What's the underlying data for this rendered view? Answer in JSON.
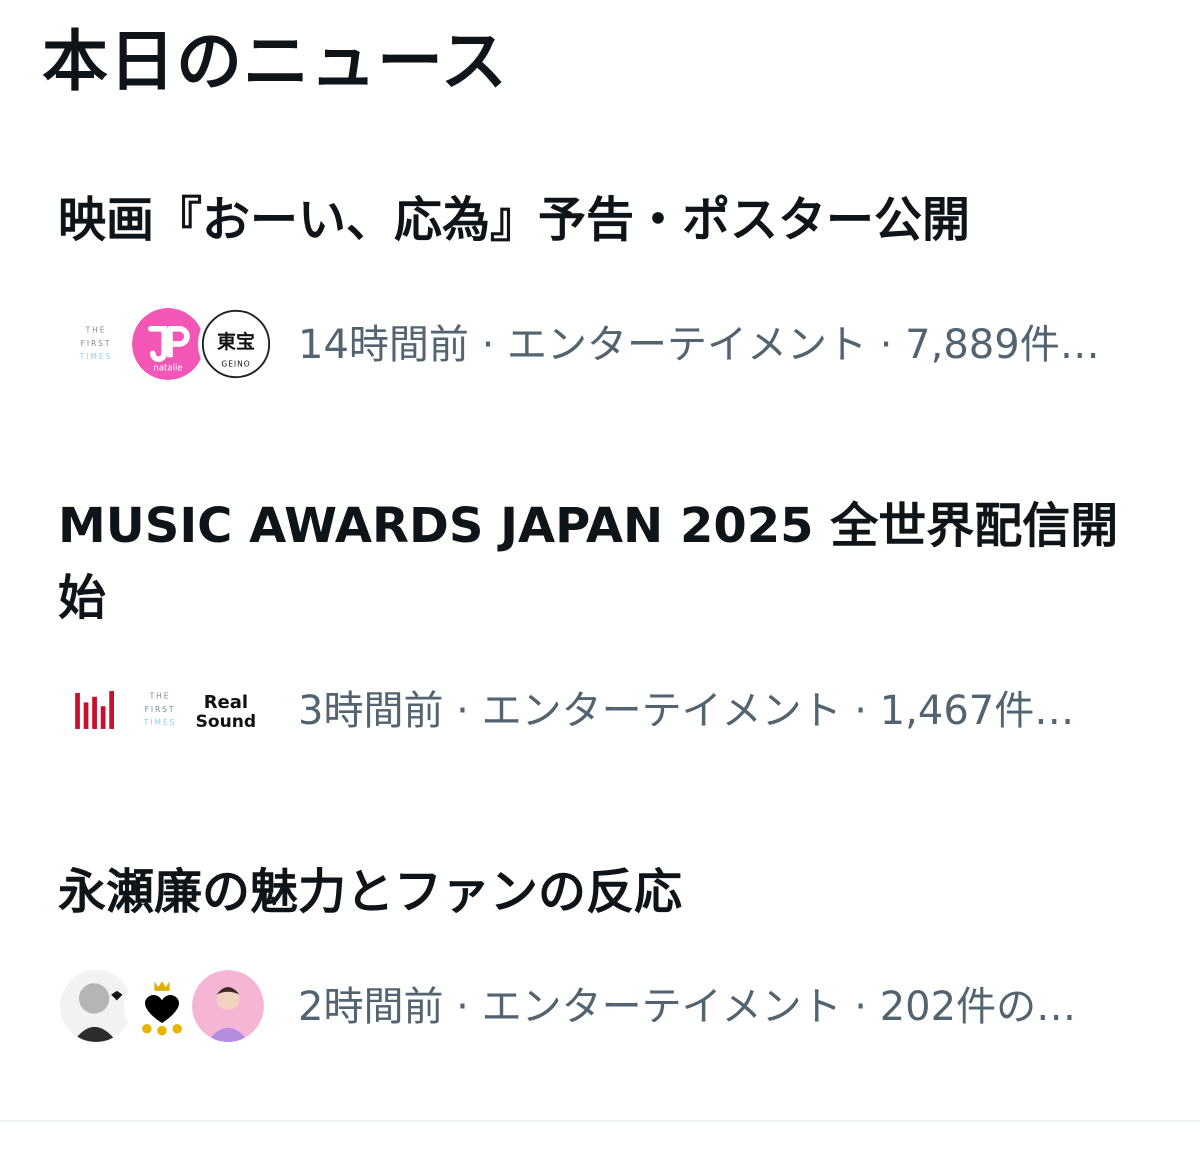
{
  "section": {
    "title": "本日のニュース"
  },
  "news": [
    {
      "headline": "映画『おーい、応為』予告・ポスター公開",
      "meta": "14時間前 · エンターテイメント · 7,889件…",
      "avatars": [
        {
          "icon": "the-first-times-logo",
          "text": "THE FIRST TIMES"
        },
        {
          "icon": "natalie-logo",
          "text": "natalie"
        },
        {
          "icon": "toho-geino-logo",
          "text": "東宝 GEINO"
        }
      ]
    },
    {
      "headline": "MUSIC AWARDS JAPAN 2025 全世界配信開始",
      "meta": "3時間前 · エンターテイメント · 1,467件…",
      "avatars": [
        {
          "icon": "music-awards-japan-logo"
        },
        {
          "icon": "the-first-times-logo",
          "text": "THE FIRST TIMES"
        },
        {
          "icon": "real-sound-logo",
          "text": "Real Sound"
        }
      ]
    },
    {
      "headline": "永瀬廉の魅力とファンの反応",
      "meta": "2時間前 · エンターテイメント · 202件の…",
      "avatars": [
        {
          "icon": "user-avatar-sketch"
        },
        {
          "icon": "user-avatar-black-heart"
        },
        {
          "icon": "user-avatar-photo"
        }
      ]
    }
  ],
  "colors": {
    "text_primary": "#0f1419",
    "text_secondary": "#536471",
    "divider": "#eff3f4",
    "natalie_pink": "#f257b8",
    "mawj_red": "#c8102e"
  }
}
